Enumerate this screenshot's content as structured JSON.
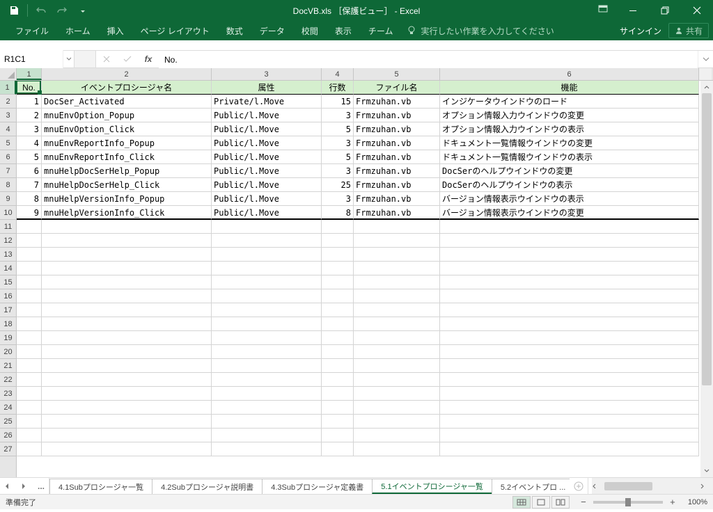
{
  "title": "DocVB.xls ［保護ビュー］ - Excel",
  "ribbon": {
    "tabs": [
      "ファイル",
      "ホーム",
      "挿入",
      "ページ レイアウト",
      "数式",
      "データ",
      "校閲",
      "表示",
      "チーム"
    ],
    "tell_me": "実行したい作業を入力してください",
    "signin": "サインイン",
    "share": "共有"
  },
  "formula_bar": {
    "name_box": "R1C1",
    "formula": "No."
  },
  "columns": [
    "1",
    "2",
    "3",
    "4",
    "5",
    "6"
  ],
  "header_row": [
    "No.",
    "イベントプロシージャ名",
    "属性",
    "行数",
    "ファイル名",
    "機能"
  ],
  "rows": [
    {
      "no": "1",
      "name": "DocSer_Activated",
      "attr": "Private/l.Move",
      "lines": "15",
      "file": "Frmzuhan.vb",
      "func": "インジケータウインドウのロード"
    },
    {
      "no": "2",
      "name": "mnuEnvOption_Popup",
      "attr": "Public/l.Move",
      "lines": "3",
      "file": "Frmzuhan.vb",
      "func": "オプション情報入力ウインドウの変更"
    },
    {
      "no": "3",
      "name": "mnuEnvOption_Click",
      "attr": "Public/l.Move",
      "lines": "5",
      "file": "Frmzuhan.vb",
      "func": "オプション情報入力ウインドウの表示"
    },
    {
      "no": "4",
      "name": "mnuEnvReportInfo_Popup",
      "attr": "Public/l.Move",
      "lines": "3",
      "file": "Frmzuhan.vb",
      "func": "ドキュメント一覧情報ウインドウの変更"
    },
    {
      "no": "5",
      "name": "mnuEnvReportInfo_Click",
      "attr": "Public/l.Move",
      "lines": "5",
      "file": "Frmzuhan.vb",
      "func": "ドキュメント一覧情報ウインドウの表示"
    },
    {
      "no": "6",
      "name": "mnuHelpDocSerHelp_Popup",
      "attr": "Public/l.Move",
      "lines": "3",
      "file": "Frmzuhan.vb",
      "func": "DocSerのヘルプウインドウの変更"
    },
    {
      "no": "7",
      "name": "mnuHelpDocSerHelp_Click",
      "attr": "Public/l.Move",
      "lines": "25",
      "file": "Frmzuhan.vb",
      "func": "DocSerのヘルプウインドウの表示"
    },
    {
      "no": "8",
      "name": "mnuHelpVersionInfo_Popup",
      "attr": "Public/l.Move",
      "lines": "3",
      "file": "Frmzuhan.vb",
      "func": "バージョン情報表示ウインドウの表示"
    },
    {
      "no": "9",
      "name": "mnuHelpVersionInfo_Click",
      "attr": "Public/l.Move",
      "lines": "8",
      "file": "Frmzuhan.vb",
      "func": "バージョン情報表示ウインドウの変更"
    }
  ],
  "empty_rows_after": 17,
  "sheet_tabs": {
    "items": [
      "4.1Subプロシージャ一覧",
      "4.2Subプロシージャ説明書",
      "4.3Subプロシージャ定義書",
      "5.1イベントプロシージャ一覧",
      "5.2イベントプロ"
    ],
    "active_index": 3,
    "ellipsis": "..."
  },
  "status": {
    "message": "準備完了",
    "zoom": "100%"
  }
}
